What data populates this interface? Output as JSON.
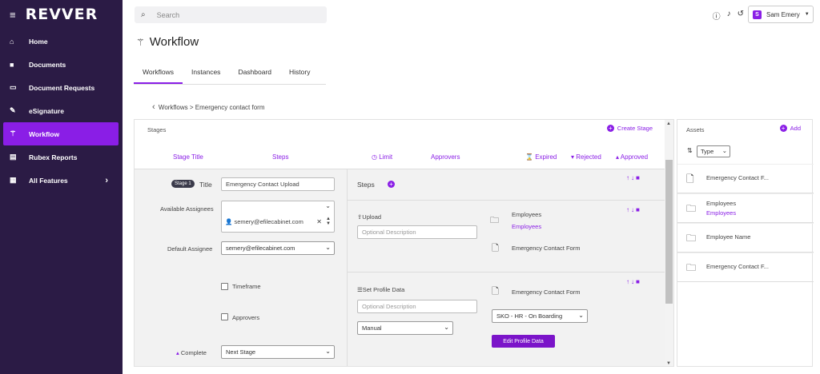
{
  "app": {
    "logo": "REVVER"
  },
  "sidebar": {
    "items": [
      {
        "label": "Home",
        "icon": "home-icon",
        "glyph": "⌂"
      },
      {
        "label": "Documents",
        "icon": "folder-icon",
        "glyph": "■"
      },
      {
        "label": "Document Requests",
        "icon": "inbox-icon",
        "glyph": "▭"
      },
      {
        "label": "eSignature",
        "icon": "signature-icon",
        "glyph": "✎"
      },
      {
        "label": "Workflow",
        "icon": "wand-icon",
        "glyph": "⚚"
      },
      {
        "label": "Rubex Reports",
        "icon": "chart-icon",
        "glyph": "▤"
      },
      {
        "label": "All Features",
        "icon": "grid-icon",
        "glyph": "▦"
      }
    ]
  },
  "header": {
    "search_placeholder": "Search",
    "user_initial": "S",
    "user_name": "Sam Emery"
  },
  "page": {
    "title": "Workflow"
  },
  "tabs": [
    {
      "label": "Workflows"
    },
    {
      "label": "Instances"
    },
    {
      "label": "Dashboard"
    },
    {
      "label": "History"
    }
  ],
  "breadcrumb": {
    "parent": "Workflows",
    "sep": ">",
    "current": "Emergency contact form"
  },
  "stages": {
    "heading": "Stages",
    "create_label": "Create Stage",
    "columns": {
      "stage_title": "Stage Title",
      "steps": "Steps",
      "limit": "Limit",
      "approvers": "Approvers",
      "expired": "Expired",
      "rejected": "Rejected",
      "approved": "Approved"
    },
    "stage": {
      "badge": "Stage 1",
      "title_label": "Title",
      "title_value": "Emergency Contact Upload",
      "available_assignees_label": "Available Assignees",
      "assignee_chip": "semery@efilecabinet.com",
      "default_assignee_label": "Default Assignee",
      "default_assignee_value": "semery@efilecabinet.com",
      "timeframe_label": "Timeframe",
      "approvers_label": "Approvers",
      "complete_label": "Complete",
      "complete_value": "Next Stage"
    },
    "steps_heading": "Steps",
    "step1": {
      "type": "Upload",
      "description_placeholder": "Optional Description",
      "folder_label": "Employees",
      "folder_link": "Employees",
      "doc_label": "Emergency Contact Form"
    },
    "step2": {
      "type": "Set Profile Data",
      "description_placeholder": "Optional Description",
      "mode_value": "Manual",
      "doc_label": "Emergency Contact Form",
      "profile_value": "SKO - HR - On Boarding",
      "edit_button": "Edit Profile Data"
    }
  },
  "assets": {
    "heading": "Assets",
    "add_label": "Add",
    "type_filter": "Type",
    "items": [
      {
        "label": "Emergency Contact F...",
        "sub": "",
        "icon": "document-icon"
      },
      {
        "label": "Employees",
        "sub": "Employees",
        "icon": "folder-icon"
      },
      {
        "label": "Employee Name",
        "sub": "",
        "icon": "folder-icon"
      },
      {
        "label": "Emergency Contact F...",
        "sub": "",
        "icon": "folder-icon"
      }
    ]
  },
  "colors": {
    "accent": "#8a1ee6",
    "sidebar_bg": "#2b1b45"
  }
}
